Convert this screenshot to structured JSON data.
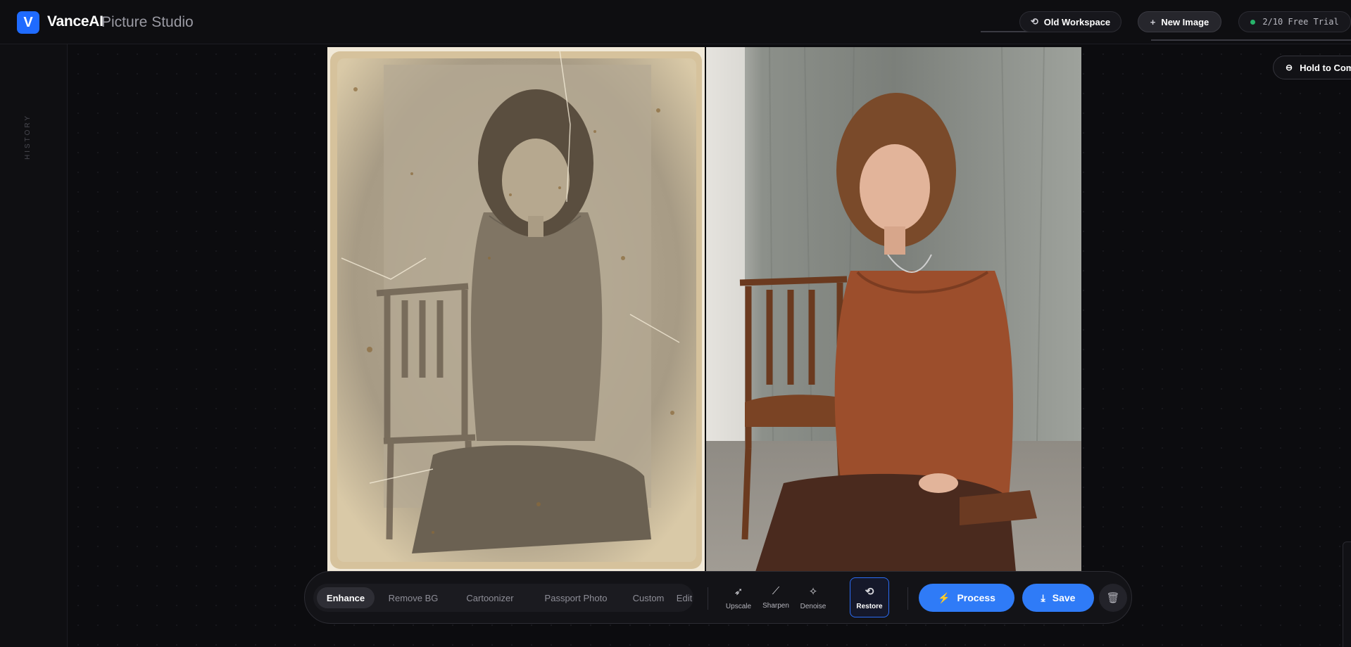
{
  "app": {
    "logo_letter": "V",
    "brand": "VanceAI",
    "product": "Picture Studio"
  },
  "header": {
    "old_workspace": "Old Workspace",
    "new_image": "New Image",
    "trial": "2/10 Free Trial",
    "trial_status_color": "#27b36a"
  },
  "sidebar": {
    "history_label": "HISTORY"
  },
  "canvas": {
    "compare_label": "Hold to Com"
  },
  "toolbar": {
    "tabs": [
      {
        "label": "Enhance",
        "active": true
      },
      {
        "label": "Remove BG",
        "active": false
      },
      {
        "label": "Cartoonizer",
        "active": false
      },
      {
        "label": "Passport Photo",
        "active": false
      },
      {
        "label": "Custom",
        "active": false
      },
      {
        "label": "Edit",
        "active": false
      }
    ],
    "tools": [
      {
        "label": "Upscale",
        "icon": "rocket-icon",
        "active": false
      },
      {
        "label": "Sharpen",
        "icon": "magic-wand-icon",
        "active": false
      },
      {
        "label": "Denoise",
        "icon": "sparkle-icon",
        "active": false
      },
      {
        "label": "Restore",
        "icon": "history-icon",
        "active": true
      }
    ],
    "process_label": "Process",
    "save_label": "Save",
    "accent_color": "#2f7bf7"
  }
}
